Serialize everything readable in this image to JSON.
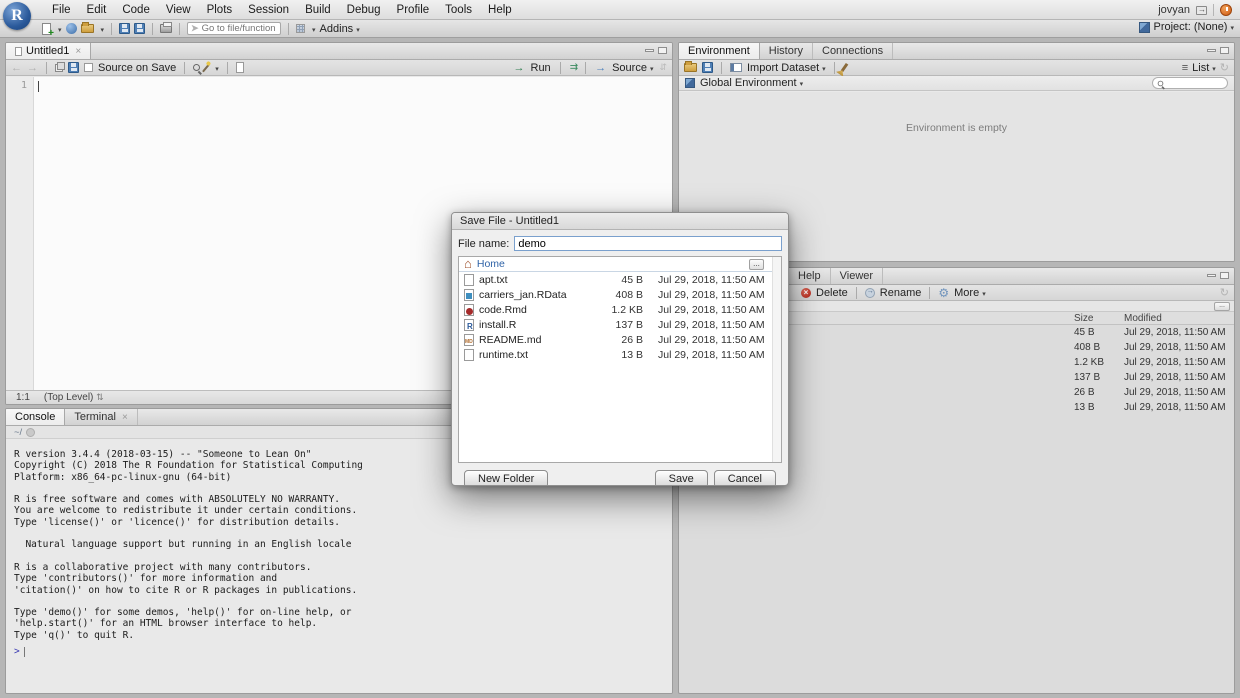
{
  "menu_bar": {
    "items": [
      "File",
      "Edit",
      "Code",
      "View",
      "Plots",
      "Session",
      "Build",
      "Debug",
      "Profile",
      "Tools",
      "Help"
    ],
    "user": "jovyan",
    "project_label": "Project: (None)"
  },
  "toolbar": {
    "goto_placeholder": "Go to file/function",
    "addins_label": "Addins"
  },
  "icons": {
    "app-logo": "R blue sphere",
    "run-arrow": "→",
    "source-arrow": "→",
    "rerun-arrows": "⇉",
    "dropdown-caret": "▾",
    "close": "×",
    "list": "≡",
    "gear": "⚙",
    "refresh": "↻",
    "home": "⌂",
    "scope-stepper": "⇅",
    "more-dots": "..."
  },
  "source_pane": {
    "tab_label": "Untitled1",
    "source_on_save_label": "Source on Save",
    "run_label": "Run",
    "source_label": "Source",
    "line_number": "1",
    "status_position": "1:1",
    "status_scope": "(Top Level)",
    "scope_glyph": "⇅"
  },
  "environment_pane": {
    "tabs": [
      "Environment",
      "History",
      "Connections"
    ],
    "import_dataset_label": "Import Dataset",
    "list_label": "List",
    "global_env_label": "Global Environment",
    "empty_message": "Environment is empty"
  },
  "files_pane": {
    "tabs": [
      "Help",
      "Viewer"
    ],
    "delete_label": "Delete",
    "rename_label": "Rename",
    "more_label": "More",
    "crumb_more": "...",
    "col_size": "Size",
    "col_modified": "Modified",
    "rows": [
      {
        "size": "45 B",
        "modified": "Jul 29, 2018, 11:50 AM"
      },
      {
        "size": "408 B",
        "modified": "Jul 29, 2018, 11:50 AM"
      },
      {
        "size": "1.2 KB",
        "modified": "Jul 29, 2018, 11:50 AM"
      },
      {
        "size": "137 B",
        "modified": "Jul 29, 2018, 11:50 AM"
      },
      {
        "size": "26 B",
        "modified": "Jul 29, 2018, 11:50 AM"
      },
      {
        "size": "13 B",
        "modified": "Jul 29, 2018, 11:50 AM"
      }
    ]
  },
  "console_pane": {
    "tabs": [
      "Console",
      "Terminal"
    ],
    "path": "~/",
    "output": [
      "R version 3.4.4 (2018-03-15) -- \"Someone to Lean On\"",
      "Copyright (C) 2018 The R Foundation for Statistical Computing",
      "Platform: x86_64-pc-linux-gnu (64-bit)",
      "",
      "R is free software and comes with ABSOLUTELY NO WARRANTY.",
      "You are welcome to redistribute it under certain conditions.",
      "Type 'license()' or 'licence()' for distribution details.",
      "",
      "  Natural language support but running in an English locale",
      "",
      "R is a collaborative project with many contributors.",
      "Type 'contributors()' for more information and",
      "'citation()' on how to cite R or R packages in publications.",
      "",
      "Type 'demo()' for some demos, 'help()' for on-line help, or",
      "'help.start()' for an HTML browser interface to help.",
      "Type 'q()' to quit R."
    ],
    "prompt": ">"
  },
  "dialog": {
    "title": "Save File - Untitled1",
    "file_name_label": "File name:",
    "file_name_value": "demo",
    "home_label": "Home",
    "browse_more": "...",
    "files": [
      {
        "icon": "txt",
        "name": "apt.txt",
        "size": "45 B",
        "modified": "Jul 29, 2018, 11:50 AM"
      },
      {
        "icon": "rdata",
        "name": "carriers_jan.RData",
        "size": "408 B",
        "modified": "Jul 29, 2018, 11:50 AM"
      },
      {
        "icon": "rmd",
        "name": "code.Rmd",
        "size": "1.2 KB",
        "modified": "Jul 29, 2018, 11:50 AM"
      },
      {
        "icon": "r",
        "name": "install.R",
        "size": "137 B",
        "modified": "Jul 29, 2018, 11:50 AM"
      },
      {
        "icon": "md",
        "name": "README.md",
        "size": "26 B",
        "modified": "Jul 29, 2018, 11:50 AM"
      },
      {
        "icon": "txt",
        "name": "runtime.txt",
        "size": "13 B",
        "modified": "Jul 29, 2018, 11:50 AM"
      }
    ],
    "new_folder_label": "New Folder",
    "save_label": "Save",
    "cancel_label": "Cancel"
  }
}
